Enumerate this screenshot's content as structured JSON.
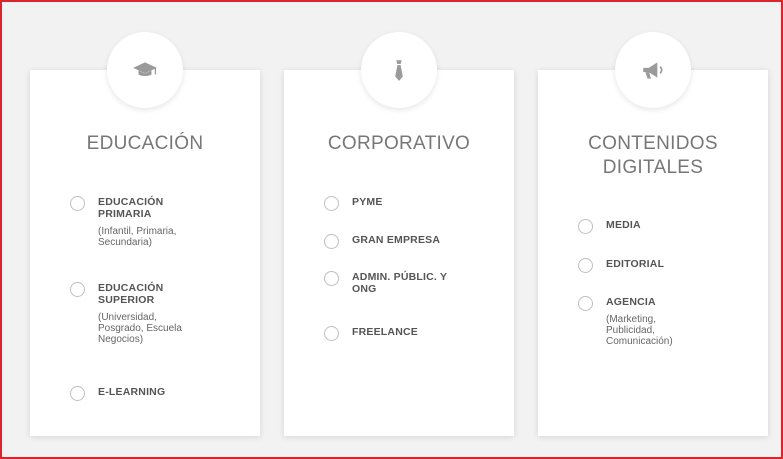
{
  "cards": [
    {
      "title": "EDUCACIÓN",
      "icon": "graduation-cap-icon",
      "options": [
        {
          "label": "EDUCACIÓN PRIMARIA",
          "sub": "(Infantil, Primaria, Secundaria)"
        },
        {
          "label": "EDUCACIÓN SUPERIOR",
          "sub": "(Universidad, Posgrado, Escuela Negocios)"
        },
        {
          "label": "E-LEARNING",
          "sub": ""
        }
      ]
    },
    {
      "title": "CORPORATIVO",
      "icon": "necktie-icon",
      "options": [
        {
          "label": "PYME"
        },
        {
          "label": "GRAN EMPRESA"
        },
        {
          "label": "ADMIN. PÚBLIC. Y ONG"
        },
        {
          "label": "FREELANCE"
        }
      ]
    },
    {
      "title": "CONTENIDOS DIGITALES",
      "icon": "megaphone-icon",
      "options": [
        {
          "label": "MEDIA"
        },
        {
          "label": "EDITORIAL"
        },
        {
          "label": "AGENCIA",
          "sub": "(Marketing, Publicidad, Comunicación)"
        }
      ]
    }
  ],
  "colors": {
    "frame_border": "#d9262c",
    "card_bg": "#ffffff",
    "page_bg": "#f2f2f2",
    "text": "#555555"
  }
}
